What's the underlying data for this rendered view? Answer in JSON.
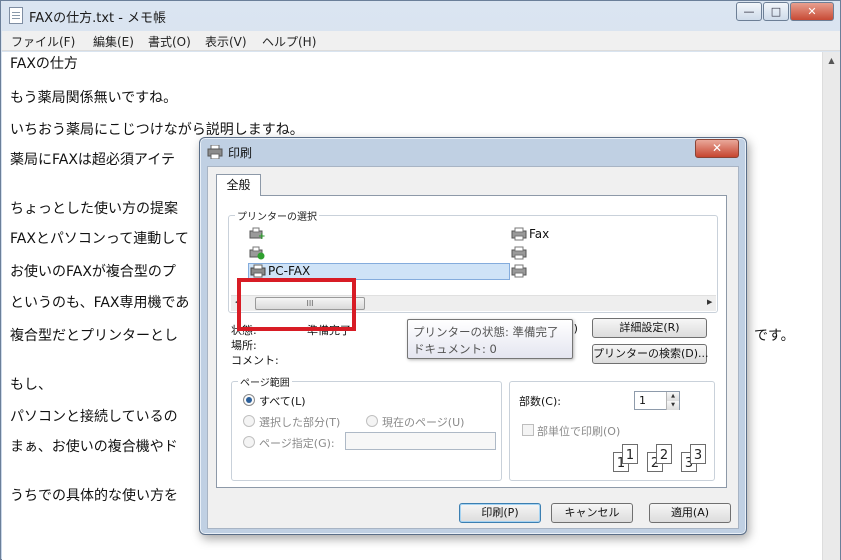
{
  "notepad": {
    "title": "FAXの仕方.txt - メモ帳",
    "window_controls": {
      "minimize": "—",
      "maximize": "□",
      "close": "✕"
    },
    "menu": [
      "ファイル(F)",
      "編集(E)",
      "書式(O)",
      "表示(V)",
      "ヘルプ(H)"
    ],
    "lines": [
      "FAXの仕方",
      "もう薬局関係無いですね。",
      "いちおう薬局にこじつけながら説明しますね。",
      "薬局にFAXは超必須アイテ",
      "ちょっとした使い方の提案",
      "FAXとパソコンって連動して",
      "お使いのFAXが複合型のプ",
      "というのも、FAX専用機であ",
      "複合型だとプリンターとし",
      "もし、",
      "パソコンと接続しているの",
      "まぁ、お使いの複合機やド",
      "うちでの具体的な使い方を"
    ],
    "trailing_text": "です。"
  },
  "dialog": {
    "title": "印刷",
    "close": "✕",
    "tab": "全般",
    "printer_group": {
      "label": "プリンターの選択",
      "printers": [
        "Fax",
        "PC-FAX"
      ],
      "scroll_thumb": "III"
    },
    "status": {
      "state_label": "状態:",
      "state_value": "準備完了",
      "location_label": "場所:",
      "comment_label": "コメント:",
      "hidden_suffix": "(F)"
    },
    "tooltip": {
      "line1": "プリンターの状態: 準備完了",
      "line2": "ドキュメント: 0"
    },
    "buttons": {
      "preferences": "詳細設定(R)",
      "find_printer": "プリンターの検索(D)...",
      "print": "印刷(P)",
      "cancel": "キャンセル",
      "apply": "適用(A)"
    },
    "page_range": {
      "label": "ページ範囲",
      "all": "すべて(L)",
      "selection": "選択した部分(T)",
      "current": "現在のページ(U)",
      "pages": "ページ指定(G):",
      "selected": "all"
    },
    "copies": {
      "label": "部数(C):",
      "value": "1",
      "collate": "部単位で印刷(O)",
      "collate_checked": false,
      "page_labels": [
        "1",
        "1",
        "2",
        "2",
        "3",
        "3"
      ]
    }
  }
}
